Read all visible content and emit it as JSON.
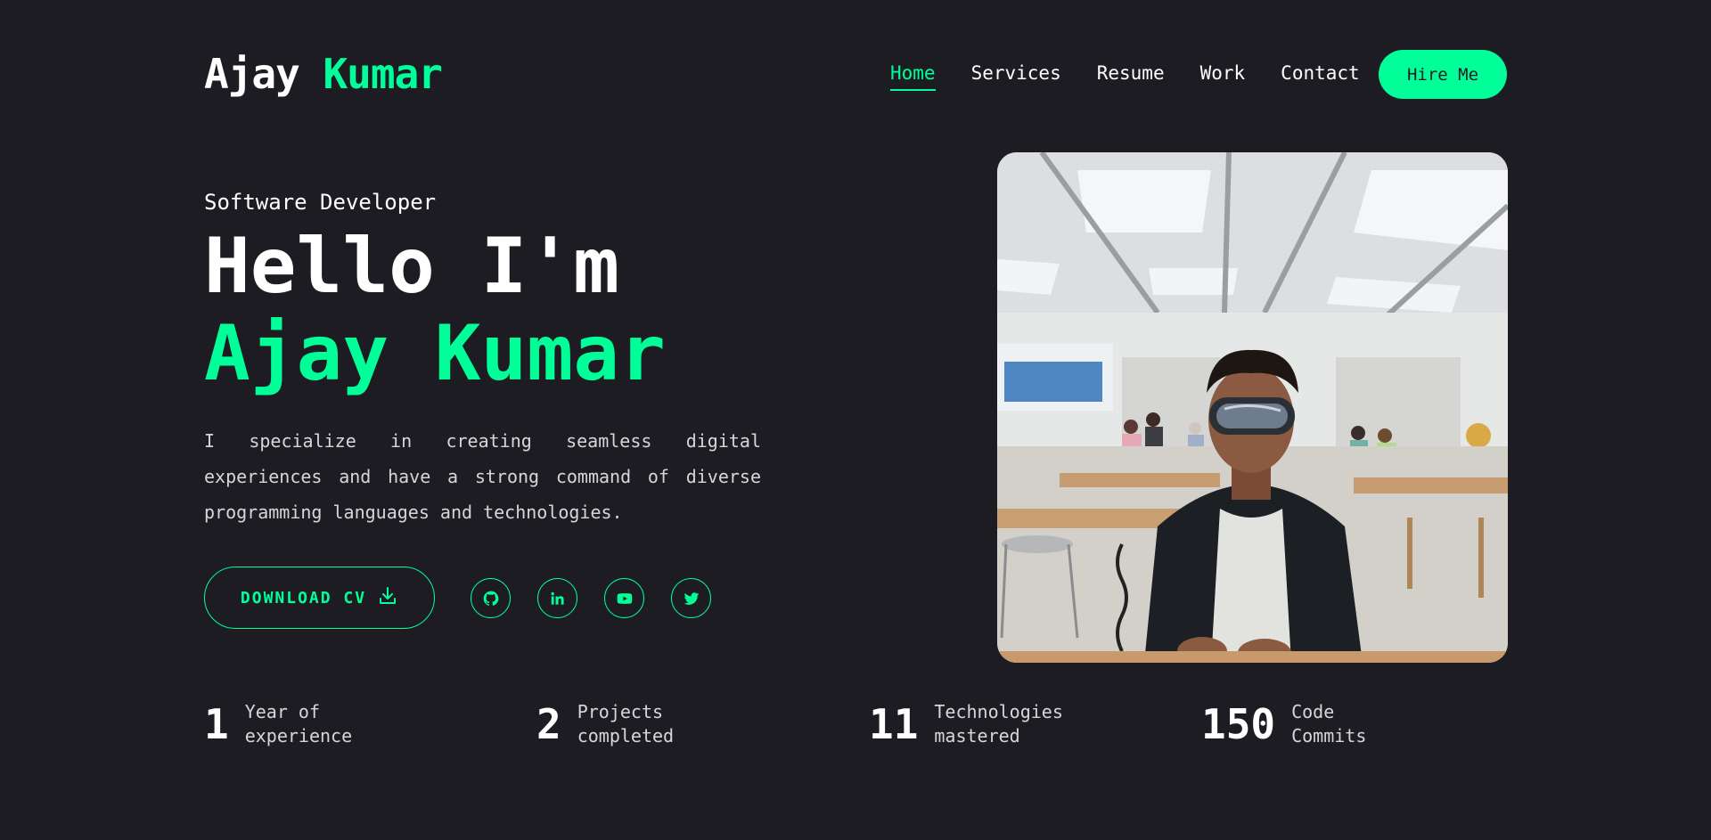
{
  "header": {
    "logo_first": "Ajay",
    "logo_accent": "Kumar",
    "nav": [
      {
        "label": "Home",
        "active": true
      },
      {
        "label": "Services",
        "active": false
      },
      {
        "label": "Resume",
        "active": false
      },
      {
        "label": "Work",
        "active": false
      },
      {
        "label": "Contact",
        "active": false
      }
    ],
    "hire_label": "Hire Me"
  },
  "hero": {
    "role": "Software Developer",
    "greeting": "Hello I'm",
    "name": "Ajay Kumar",
    "description": "I specialize in creating seamless digital experiences and have a strong command of diverse programming languages and technologies.",
    "cv_label": "DOWNLOAD CV",
    "cv_icon": "download-icon",
    "socials": [
      {
        "icon": "github-icon"
      },
      {
        "icon": "linkedin-icon"
      },
      {
        "icon": "youtube-icon"
      },
      {
        "icon": "twitter-icon"
      }
    ],
    "photo_icon": "profile-photo"
  },
  "stats": [
    {
      "value": "1",
      "label": "Year of experience"
    },
    {
      "value": "2",
      "label": "Projects completed"
    },
    {
      "value": "11",
      "label": "Technologies mastered"
    },
    {
      "value": "150",
      "label": "Code Commits"
    }
  ],
  "colors": {
    "background": "#1c1c22",
    "accent": "#00ff99",
    "text": "#ffffff"
  }
}
